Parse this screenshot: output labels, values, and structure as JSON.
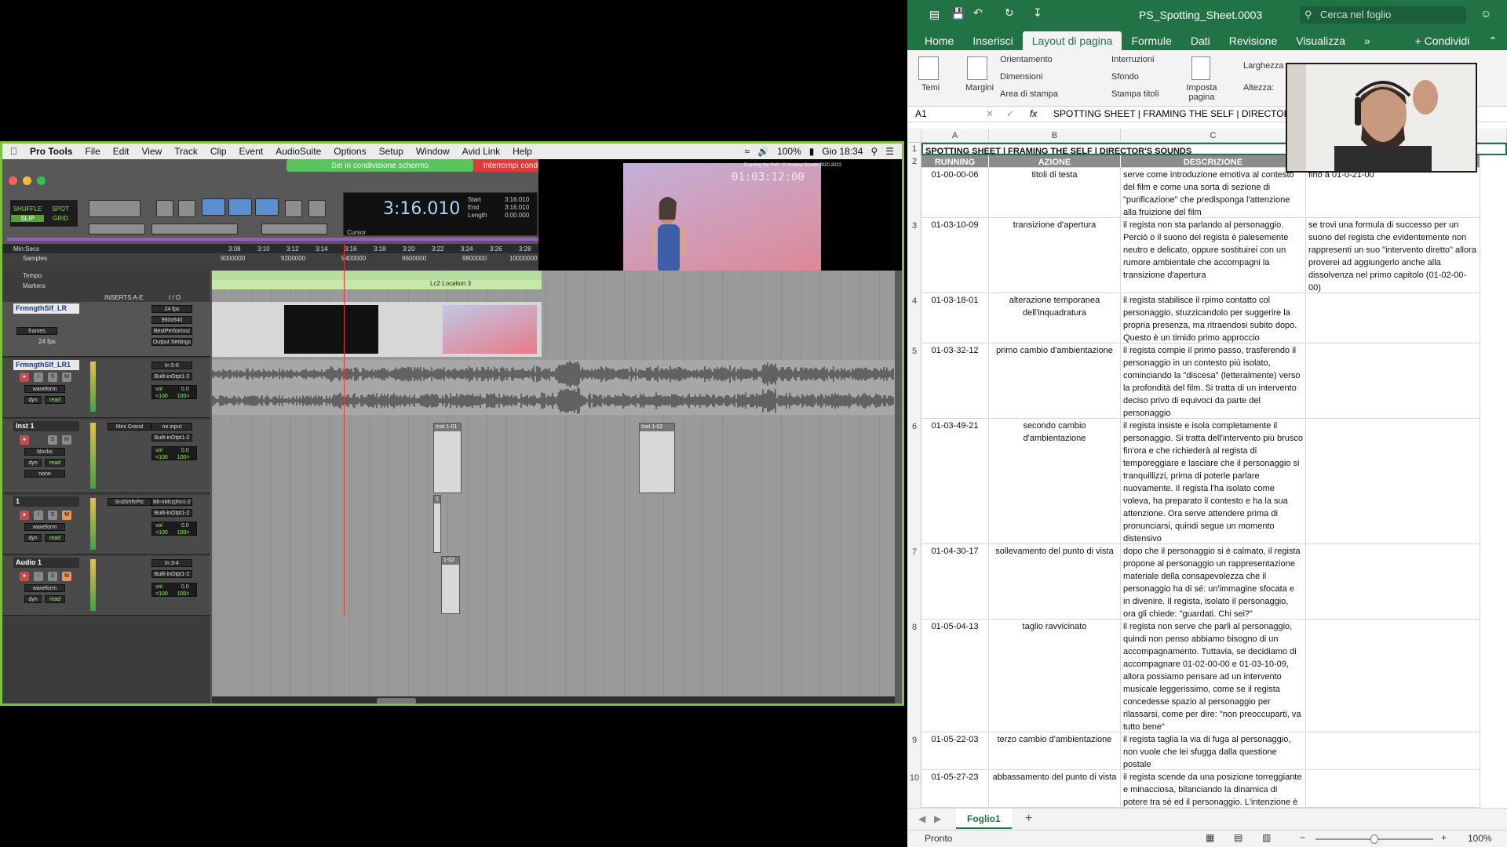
{
  "protools": {
    "menu": [
      "Pro Tools",
      "File",
      "Edit",
      "View",
      "Track",
      "Clip",
      "Event",
      "AudioSuite",
      "Options",
      "Setup",
      "Window",
      "Avid Link",
      "Help"
    ],
    "status_right": {
      "battery": "100%",
      "clock": "Gio 18:34"
    },
    "share_banner": "Sei in condivisione schermo",
    "stop_share": "Interrompi condivisione",
    "modes": [
      "SHUFFLE",
      "SPOT",
      "SLIP",
      "GRID"
    ],
    "counter": {
      "main": "3:16.010",
      "start_label": "Start",
      "end_label": "End",
      "length_label": "Length",
      "start": "3:16.010",
      "end": "3:16.010",
      "length": "0:00.000",
      "cursor_label": "Cursor"
    },
    "video": {
      "timecode": "01:03:12:00",
      "credit": "Framing the Self - © Andrea Orsetti 2020-2022"
    },
    "ruler": {
      "minsecs_label": "Min:Secs",
      "samples_label": "Samples",
      "tempo_label": "Tempo",
      "markers_label": "Markers",
      "ticks": [
        "3:08",
        "3:10",
        "3:12",
        "3:14",
        "3:16",
        "3:18",
        "3:20",
        "3:22",
        "3:24",
        "3:26",
        "3:28"
      ],
      "sample_ticks": [
        "9000000",
        "9200000",
        "9400000",
        "9600000",
        "9800000",
        "10000000"
      ],
      "marker": "Lc2 Location 3"
    },
    "columns": {
      "inserts": "INSERTS A-E",
      "io": "I / O"
    },
    "tracks": [
      {
        "name": "FrmngthSlf_LR",
        "view": "frames",
        "fps": "24 fps",
        "io": [
          "24 fps",
          "960x540",
          "BestPerformnc",
          "Output Settings"
        ]
      },
      {
        "name": "FrmngthSlf_LR1",
        "view": "waveform",
        "dyn": "dyn",
        "read": "read",
        "io_in": "In 5-6",
        "io_out": "Built-inOtpt1-2",
        "vol": "vol",
        "vol_val": "0.0",
        "pan_l": "<100",
        "pan_r": "100>"
      },
      {
        "name": "Inst 1",
        "insert": "Mini Grand",
        "view": "blocks",
        "dyn": "dyn",
        "read": "read",
        "none": "none",
        "io_in": "no input",
        "io_out": "Built-inOtpt1-2",
        "vol": "vol",
        "vol_val": "0.0",
        "pan_l": "<100",
        "pan_r": "100>"
      },
      {
        "name": "1",
        "insert": "SndShftrPtc",
        "view": "waveform",
        "dyn": "dyn",
        "read": "read",
        "io_in": "Blt-nMcrphn1-2",
        "io_out": "Built-inOtpt1-2",
        "vol": "vol",
        "vol_val": "0.0",
        "pan_l": "<100",
        "pan_r": "100>"
      },
      {
        "name": "Audio 1",
        "view": "waveform",
        "dyn": "dyn",
        "read": "read",
        "io_in": "In 3-4",
        "io_out": "Built-inOtpt1-2",
        "vol": "vol",
        "vol_val": "0.0",
        "pan_l": "<100",
        "pan_r": "100>"
      }
    ],
    "clips": {
      "inst1a": "Inst 1-01",
      "inst1b": "Inst 1-02",
      "one": "1",
      "audio": "1-02"
    }
  },
  "excel": {
    "filename": "PS_Spotting_Sheet.0003",
    "search_placeholder": "Cerca nel foglio",
    "tabs": [
      "Home",
      "Inserisci",
      "Layout di pagina",
      "Formule",
      "Dati",
      "Revisione",
      "Visualizza"
    ],
    "active_tab": "Layout di pagina",
    "share": "Condividi",
    "ribbon": {
      "temi": "Temi",
      "margini": "Margini",
      "orientamento": "Orientamento",
      "dimensioni": "Dimensioni",
      "area_stampa": "Area di stampa",
      "interruzioni": "Interruzioni",
      "sfondo": "Sfondo",
      "stampa_titoli": "Stampa titoli",
      "imposta_pagina": "Imposta pagina",
      "larghezza": "Larghezza",
      "altezza": "Altezza:"
    },
    "cell_ref": "A1",
    "formula": "SPOTTING SHEET | FRAMING THE SELF | DIRECTOR'S",
    "col_letters": [
      "A",
      "B",
      "C"
    ],
    "title_row": "SPOTTING SHEET | FRAMING THE SELF | DIRECTOR'S SOUNDS",
    "headers": [
      "RUNNING TIME",
      "AZIONE",
      "DESCRIZIONE"
    ],
    "rows": [
      {
        "n": "3",
        "tc": "01-00-00-06",
        "azione": "titoli di testa",
        "desc": "serve come introduzione emotiva al contesto del film e come una sorta di sezione di \"purificazione\" che predisponga l'attenzione alla fruizione del film",
        "note": "fino a 01-0-21-00"
      },
      {
        "n": "4",
        "tc": "01-03-10-09",
        "azione": "transizione d'apertura",
        "desc": "il regista non sta parlando al personaggio. Perciò o il suono del regista è palesemente neutro e delicato, oppure sostituirei con un rumore ambientale che accompagni la transizione d'apertura",
        "note": "se trovi una formula di successo per un suono del regista che evidentemente non rappresenti un suo \"intervento diretto\" allora proverei ad aggiungerlo anche alla dissolvenza nel primo capitolo (01-02-00-00)"
      },
      {
        "n": "5",
        "tc": "01-03-18-01",
        "azione": "alterazione temporanea dell'inquadratura",
        "desc": "il regista stabilisce il rpimo contatto col personaggio, stuzzicandolo per suggerire la propria presenza, ma ritraendosi subito dopo. Questo è un timido primo approccio",
        "note": ""
      },
      {
        "n": "6",
        "tc": "01-03-32-12",
        "azione": "primo cambio d'ambientazione",
        "desc": "il regista compie il primo passo, trasferendo il personaggio in un contesto più isolato, cominciando la \"discesa\" (letteralmente) verso la profondità del film. Si tratta di un intervento deciso privo di equivoci da parte del personaggio",
        "note": ""
      },
      {
        "n": "7",
        "tc": "01-03-49-21",
        "azione": "secondo cambio d'ambientazione",
        "desc": "il regista insiste e isola completamente il personaggio. Si tratta dell'intervento più brusco fin'ora e che richiederà al regista di temporeggiare e lasciare che il personaggio si tranquillizzi, prima di poterle parlare nuovamente. Il regista l'ha isolato come voleva, ha preparato il contesto e ha la sua attenzione. Ora serve attendere prima di pronunciarsi, quindi segue un momento distensivo",
        "note": ""
      },
      {
        "n": "8",
        "tc": "01-04-30-17",
        "azione": "sollevamento del punto di vista",
        "desc": "dopo che il personaggio si è calmato, il regista propone al personaggio un rappresentazione materiale della consapevolezza che il personaggio ha di sé: un'immagine sfocata e in divenire. Il regista, isolato il personaggio, ora gli chiede: \"guardati. Chi sei?\"",
        "note": ""
      },
      {
        "n": "9",
        "tc": "01-05-04-13",
        "azione": "taglio ravvicinato",
        "desc": "il regista non serve che parli al personaggio, quindi non penso abbiamo bisogno di un accompagnamento. Tuttavia, se decidiamo di accompagnare 01-02-00-00 e 01-03-10-09, allora possiamo pensare ad un intervento musicale leggerissimo, come se il regista concedesse spazio al personaggio per rilassarsi, come per dire: \"non preoccuparti, va tutto bene\"",
        "note": ""
      },
      {
        "n": "10",
        "tc": "01-05-22-03",
        "azione": "terzo cambio d'ambientazione",
        "desc": "il regista taglia la via di fuga al personaggio, non vuole che lei sfugga dalla questione postale",
        "note": ""
      },
      {
        "n": "",
        "tc": "01-05-27-23",
        "azione": "abbassamento del punto di vista",
        "desc": "il regista scende da una posizione torreggiante e minacciosa, bilanciando la dinamica di potere tra sé ed il personaggio. L'intenzione è di",
        "note": ""
      }
    ],
    "sheet_tab": "Foglio1",
    "status": "Pronto",
    "zoom": "100%"
  }
}
